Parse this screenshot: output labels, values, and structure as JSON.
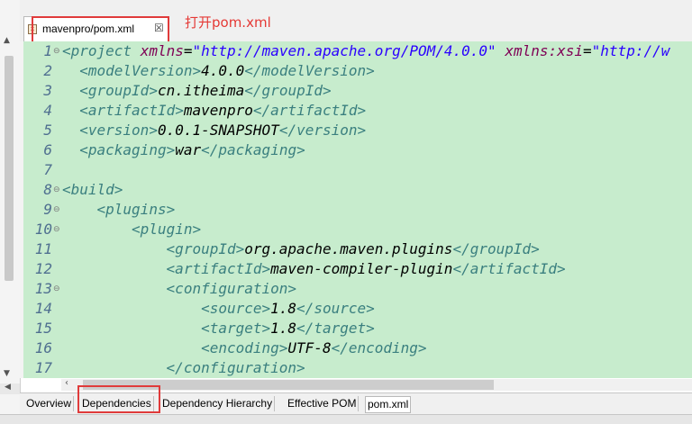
{
  "editor_tab": {
    "label": "mavenpro/pom.xml",
    "close": "☒",
    "icon": "xml-file-icon"
  },
  "annotation": "打开pom.xml",
  "lines": [
    {
      "num": "1",
      "indent": "",
      "parts": [
        {
          "c": "tag",
          "t": "<project "
        },
        {
          "c": "attr",
          "t": "xmlns"
        },
        {
          "c": "val",
          "t": "="
        },
        {
          "c": "str",
          "t": "\"http://maven.apache.org/POM/4.0.0\""
        },
        {
          "c": "val",
          "t": " "
        },
        {
          "c": "attr",
          "t": "xmlns:xsi"
        },
        {
          "c": "val",
          "t": "="
        },
        {
          "c": "str",
          "t": "\"http://w"
        }
      ]
    },
    {
      "num": "2",
      "indent": "  ",
      "parts": [
        {
          "c": "tag",
          "t": "<modelVersion>"
        },
        {
          "c": "val",
          "t": "4.0.0"
        },
        {
          "c": "tag",
          "t": "</modelVersion>"
        }
      ]
    },
    {
      "num": "3",
      "indent": "  ",
      "parts": [
        {
          "c": "tag",
          "t": "<groupId>"
        },
        {
          "c": "val",
          "t": "cn.itheima"
        },
        {
          "c": "tag",
          "t": "</groupId>"
        }
      ]
    },
    {
      "num": "4",
      "indent": "  ",
      "parts": [
        {
          "c": "tag",
          "t": "<artifactId>"
        },
        {
          "c": "val",
          "t": "mavenpro"
        },
        {
          "c": "tag",
          "t": "</artifactId>"
        }
      ]
    },
    {
      "num": "5",
      "indent": "  ",
      "parts": [
        {
          "c": "tag",
          "t": "<version>"
        },
        {
          "c": "val",
          "t": "0.0.1-SNAPSHOT"
        },
        {
          "c": "tag",
          "t": "</version>"
        }
      ]
    },
    {
      "num": "6",
      "indent": "  ",
      "parts": [
        {
          "c": "tag",
          "t": "<packaging>"
        },
        {
          "c": "val",
          "t": "war"
        },
        {
          "c": "tag",
          "t": "</packaging>"
        }
      ]
    },
    {
      "num": "7",
      "indent": "",
      "parts": []
    },
    {
      "num": "8",
      "indent": "",
      "parts": [
        {
          "c": "tag",
          "t": "<build>"
        }
      ]
    },
    {
      "num": "9",
      "indent": "    ",
      "parts": [
        {
          "c": "tag",
          "t": "<plugins>"
        }
      ]
    },
    {
      "num": "10",
      "indent": "        ",
      "parts": [
        {
          "c": "tag",
          "t": "<plugin>"
        }
      ]
    },
    {
      "num": "11",
      "indent": "            ",
      "parts": [
        {
          "c": "tag",
          "t": "<groupId>"
        },
        {
          "c": "val",
          "t": "org.apache.maven.plugins"
        },
        {
          "c": "tag",
          "t": "</groupId>"
        }
      ]
    },
    {
      "num": "12",
      "indent": "            ",
      "parts": [
        {
          "c": "tag",
          "t": "<artifactId>"
        },
        {
          "c": "val",
          "t": "maven-compiler-plugin"
        },
        {
          "c": "tag",
          "t": "</artifactId>"
        }
      ]
    },
    {
      "num": "13",
      "indent": "            ",
      "parts": [
        {
          "c": "tag",
          "t": "<configuration>"
        }
      ]
    },
    {
      "num": "14",
      "indent": "                ",
      "parts": [
        {
          "c": "tag",
          "t": "<source>"
        },
        {
          "c": "val",
          "t": "1.8"
        },
        {
          "c": "tag",
          "t": "</source>"
        }
      ]
    },
    {
      "num": "15",
      "indent": "                ",
      "parts": [
        {
          "c": "tag",
          "t": "<target>"
        },
        {
          "c": "val",
          "t": "1.8"
        },
        {
          "c": "tag",
          "t": "</target>"
        }
      ]
    },
    {
      "num": "16",
      "indent": "                ",
      "parts": [
        {
          "c": "tag",
          "t": "<encoding>"
        },
        {
          "c": "val",
          "t": "UTF-8"
        },
        {
          "c": "tag",
          "t": "</encoding>"
        }
      ]
    },
    {
      "num": "17",
      "indent": "            ",
      "parts": [
        {
          "c": "tag",
          "t": "</configuration>"
        }
      ]
    }
  ],
  "fold_lines": [
    "1",
    "8",
    "9",
    "10",
    "13"
  ],
  "bottom_tabs": [
    "Overview",
    "Dependencies",
    "Dependency Hierarchy",
    "Effective POM",
    "pom.xml"
  ],
  "active_bottom_tab": "pom.xml",
  "colors": {
    "line_highlight": "#c7eccd",
    "tag": "#3a7f7f",
    "attr": "#7f0055",
    "string": "#2a00ff",
    "annotation": "#e53935",
    "red_box": "#e03b3b"
  }
}
